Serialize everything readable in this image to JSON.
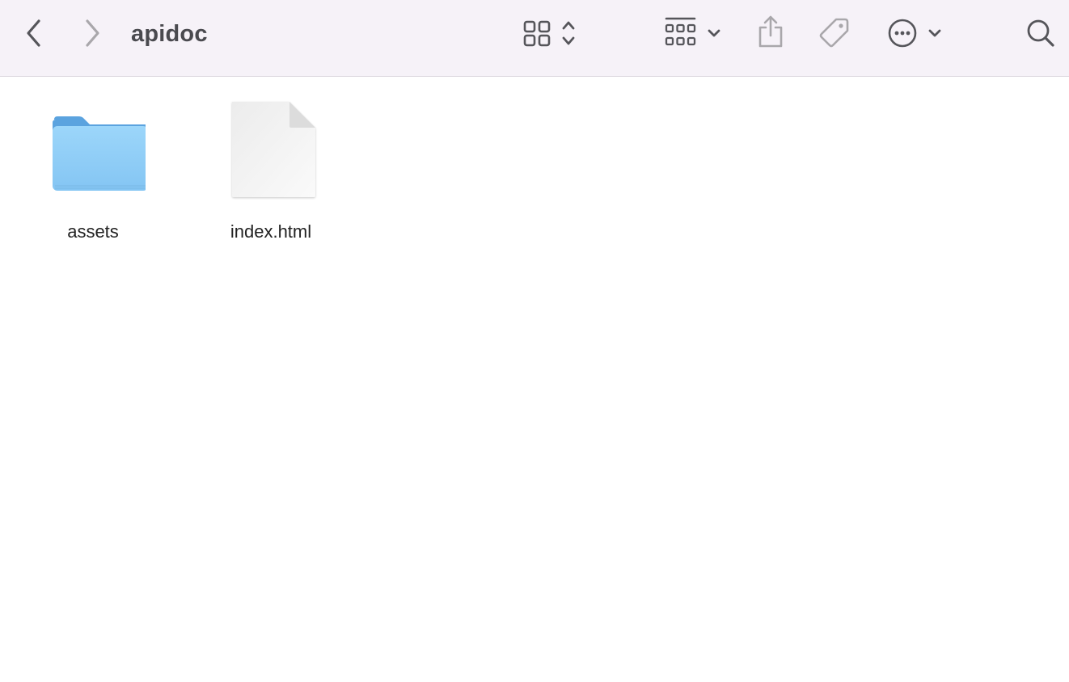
{
  "window": {
    "title": "apidoc"
  },
  "toolbar": {
    "back_icon": "chevron-left-icon",
    "forward_icon": "chevron-right-icon",
    "view_mode_icon": "icon-grid-view-icon",
    "group_icon": "group-by-icon",
    "share_icon": "share-icon",
    "tag_icon": "tag-icon",
    "more_icon": "ellipsis-circle-icon",
    "search_icon": "search-icon"
  },
  "files": [
    {
      "name": "assets",
      "kind": "folder",
      "icon": "folder-icon"
    },
    {
      "name": "index.html",
      "kind": "document",
      "icon": "document-icon"
    }
  ],
  "colors": {
    "toolbar_bg": "#f6f2f8",
    "folder_blue": "#8fcdf6",
    "folder_tab": "#5ba3df"
  }
}
